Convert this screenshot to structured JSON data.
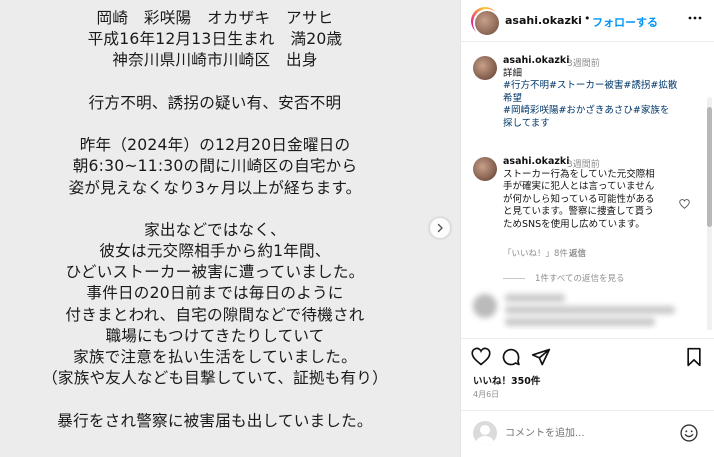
{
  "post_image": {
    "lines": [
      "岡崎　彩咲陽　オカザキ　アサヒ",
      "平成16年12月13日生まれ　満20歳",
      "神奈川県川崎市川崎区　出身",
      "",
      "行方不明、誘拐の疑い有、安否不明",
      "",
      "昨年（2024年）の12月20日金曜日の",
      "朝6:30~11:30の間に川崎区の自宅から",
      "姿が見えなくなり3ヶ月以上が経ちます。",
      "",
      "家出などではなく、",
      "彼女は元交際相手から約1年間、",
      "ひどいストーカー被害に遭っていました。",
      "事件日の20日前までは毎日のように",
      "付きまとわれ、自宅の隙間などで待機され",
      "職場にもつけてきたりしていて",
      "家族で注意を払い生活をしていました。",
      "（家族や友人なども目撃していて、証拠も有り）",
      "",
      "暴行をされ警察に被害届も出していました。"
    ],
    "next_icon": "chevron-right-icon"
  },
  "header": {
    "username": "asahi.okazki",
    "separator": "•",
    "follow_label": "フォローする",
    "more_icon": "more-horizontal-icon"
  },
  "comments": [
    {
      "username": "asahi.okazki",
      "time": "3週間前",
      "body_lines": [
        [
          {
            "t": "詳細",
            "tag": false
          }
        ],
        [
          {
            "t": "#行方不明#ストーカー被害#誘拐#拡散",
            "tag": true
          }
        ],
        [
          {
            "t": "希望",
            "tag": true
          }
        ],
        [
          {
            "t": "#岡崎彩咲陽#おかざきあさひ#家族を",
            "tag": true
          }
        ],
        [
          {
            "t": "探してます",
            "tag": true
          }
        ]
      ]
    },
    {
      "username": "asahi.okazki",
      "time": "3週間前",
      "body_lines": [
        [
          {
            "t": "ストーカー行為をしていた元交際相",
            "tag": false
          }
        ],
        [
          {
            "t": "手が確実に犯人とは言っていません",
            "tag": false
          }
        ],
        [
          {
            "t": "が何かしら知っている可能性がある",
            "tag": false
          }
        ],
        [
          {
            "t": "と見ています。警察に捜査して貰う",
            "tag": false
          }
        ],
        [
          {
            "t": "ためSNSを使用し広めています。",
            "tag": false
          }
        ]
      ],
      "likes_label": "「いいね！」8件",
      "reply_label": "返信",
      "view_replies_label": "1件すべての返信を見る"
    }
  ],
  "actions": {
    "like_icon": "heart-icon",
    "comment_icon": "comment-icon",
    "share_icon": "send-icon",
    "save_icon": "bookmark-icon",
    "likes_count": "いいね！350件",
    "date": "4月6日"
  },
  "comment_input": {
    "placeholder": "コメントを追加...",
    "emoji_icon": "emoji-icon"
  }
}
